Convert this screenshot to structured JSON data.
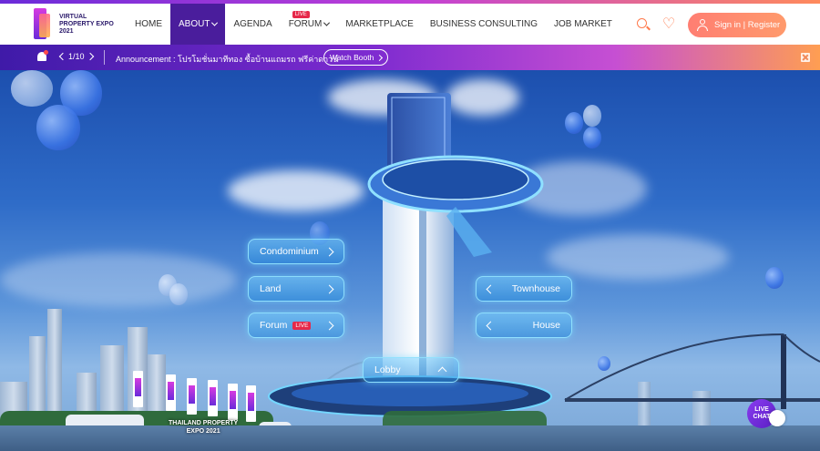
{
  "brand": {
    "logo_text": "VIRTUAL\nPROPERTY EXPO\n2021"
  },
  "nav": {
    "items": [
      {
        "label": "HOME"
      },
      {
        "label": "ABOUT",
        "dropdown": true,
        "active": true
      },
      {
        "label": "AGENDA"
      },
      {
        "label": "FORUM",
        "dropdown": true,
        "badge": "LIVE"
      },
      {
        "label": "MARKETPLACE"
      },
      {
        "label": "BUSINESS CONSULTING"
      },
      {
        "label": "JOB MARKET"
      }
    ],
    "search_icon": "search-icon",
    "favorites_icon": "heart-icon",
    "signin_label": "Sign in | Register"
  },
  "announcement": {
    "pager": "1/10",
    "text": "Announcement : โปรโมชั่นมาทีทอง ซื้อบ้านแถมรถ ฟรีค่าดาวน์",
    "watch_label": "Watch Booth"
  },
  "scene": {
    "zones": {
      "condominium": "Condominium",
      "land": "Land",
      "forum": "Forum",
      "forum_badge": "LIVE",
      "townhouse": "Townhouse",
      "house": "House",
      "lobby": "Lobby"
    },
    "expo_label": "THAILAND PROPERTY\nEXPO 2021",
    "live_chat_label": "LIVE\nCHAT"
  },
  "colors": {
    "accent": "#ff7a4c",
    "nav_active": "#4a1d9c",
    "live": "#e6284a"
  }
}
